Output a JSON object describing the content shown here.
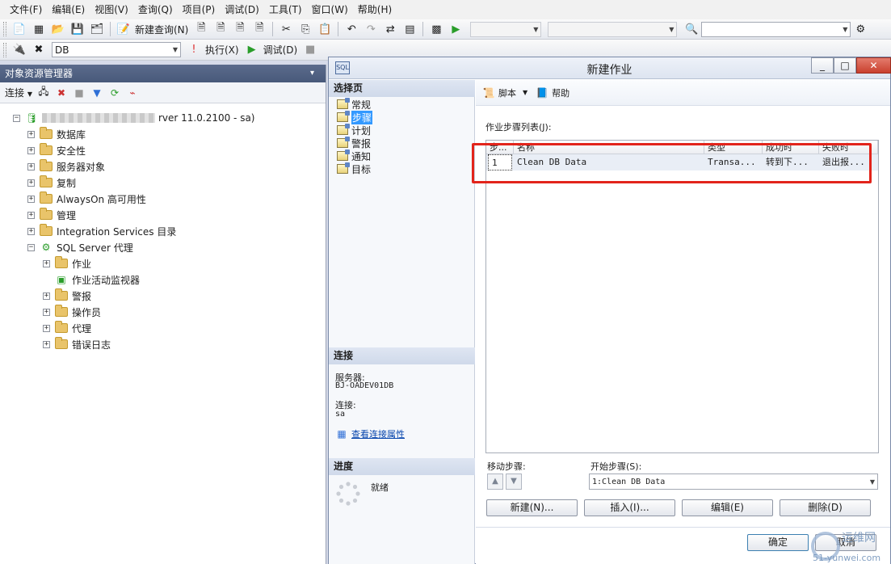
{
  "menu": [
    "文件(F)",
    "编辑(E)",
    "视图(V)",
    "查询(Q)",
    "项目(P)",
    "调试(D)",
    "工具(T)",
    "窗口(W)",
    "帮助(H)"
  ],
  "toolbar1": {
    "new_query": "新建查询(N)"
  },
  "toolbar2": {
    "db_value": "DB",
    "execute": "执行(X)",
    "debug": "调试(D)"
  },
  "object_explorer": {
    "title": "对象资源管理器",
    "connect": "连接",
    "server_suffix": "rver 11.0.2100 - sa)",
    "nodes": {
      "databases": "数据库",
      "security": "安全性",
      "server_objects": "服务器对象",
      "replication": "复制",
      "alwayson": "AlwaysOn 高可用性",
      "management": "管理",
      "integration": "Integration Services 目录",
      "agent": "SQL Server 代理",
      "jobs": "作业",
      "job_monitor": "作业活动监视器",
      "alerts": "警报",
      "operators": "操作员",
      "proxies": "代理",
      "error_logs": "错误日志"
    }
  },
  "dialog": {
    "title": "新建作业",
    "select_page_header": "选择页",
    "pages": [
      "常规",
      "步骤",
      "计划",
      "警报",
      "通知",
      "目标"
    ],
    "selected_page": "步骤",
    "connection_header": "连接",
    "server_label": "服务器:",
    "server_value": "BJ-OADEV01DB",
    "conn_label": "连接:",
    "conn_value": "sa",
    "view_conn_link": "查看连接属性",
    "progress_header": "进度",
    "progress_status": "就绪",
    "toolbar": {
      "script": "脚本",
      "help": "帮助"
    },
    "steps_list_label": "作业步骤列表(J):",
    "columns": [
      "步...",
      "名称",
      "类型",
      "成功时",
      "失败时"
    ],
    "rows": [
      {
        "step": "1",
        "name": "Clean DB Data",
        "type": "Transa...",
        "on_success": "转到下...",
        "on_failure": "退出报..."
      }
    ],
    "move_step_label": "移动步骤:",
    "start_step_label": "开始步骤(S):",
    "start_step_value": "1:Clean DB Data",
    "buttons": {
      "new": "新建(N)...",
      "insert": "插入(I)...",
      "edit": "编辑(E)",
      "delete": "删除(D)",
      "ok": "确定",
      "cancel": "取消"
    }
  },
  "watermark": {
    "top": "运维网",
    "bottom": "51-yunwei.com"
  }
}
